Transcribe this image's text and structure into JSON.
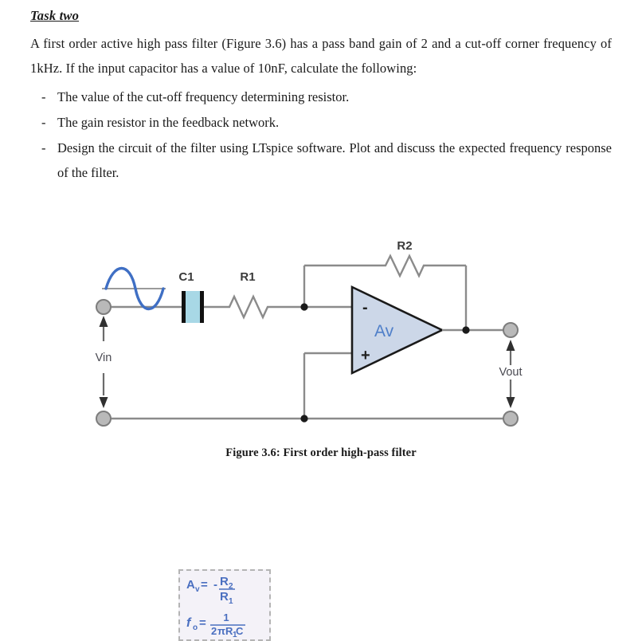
{
  "document": {
    "heading": "Task two",
    "paragraph": "A first order active high pass filter (Figure 3.6) has a pass band gain of 2 and a cut-off corner frequency of 1kHz. If the input capacitor has a value of 10nF, calculate the following:",
    "bullet_marker": "-",
    "bullets": [
      "The value of the cut-off frequency determining resistor.",
      "The gain resistor in the feedback network.",
      "Design the circuit of the filter using LTspice software. Plot and discuss the expected frequency response of the filter."
    ]
  },
  "figure": {
    "caption": "Figure 3.6: First order high-pass filter",
    "labels": {
      "capacitor": "C1",
      "resistor_input": "R1",
      "resistor_feedback": "R2",
      "opamp_gain": "Av",
      "opamp_inverting": "-",
      "opamp_noninverting": "+",
      "input_port": "Vin",
      "output_port": "Vout"
    },
    "formula_box": {
      "gain_symbol": "A",
      "gain_subscript": "v",
      "gain_equals": "=",
      "gain_sign": "-",
      "gain_numerator": "R",
      "gain_numerator_sub": "2",
      "gain_denominator": "R",
      "gain_denominator_sub": "1",
      "freq_symbol": "f",
      "freq_subscript": "o",
      "freq_equals": "=",
      "freq_numerator": "1",
      "freq_denominator_a": "2",
      "freq_denominator_pi": "π",
      "freq_denominator_r": "R",
      "freq_denominator_rsub": "1",
      "freq_denominator_c": "C"
    },
    "colors": {
      "wire": "#8b8b8b",
      "opamp_fill": "#ccd7e8",
      "capacitor_fill": "#a8d8e6",
      "source_wave": "#3f6fc4",
      "formula_text": "#4a6fc0",
      "formula_bg": "#f4f2f8"
    }
  }
}
